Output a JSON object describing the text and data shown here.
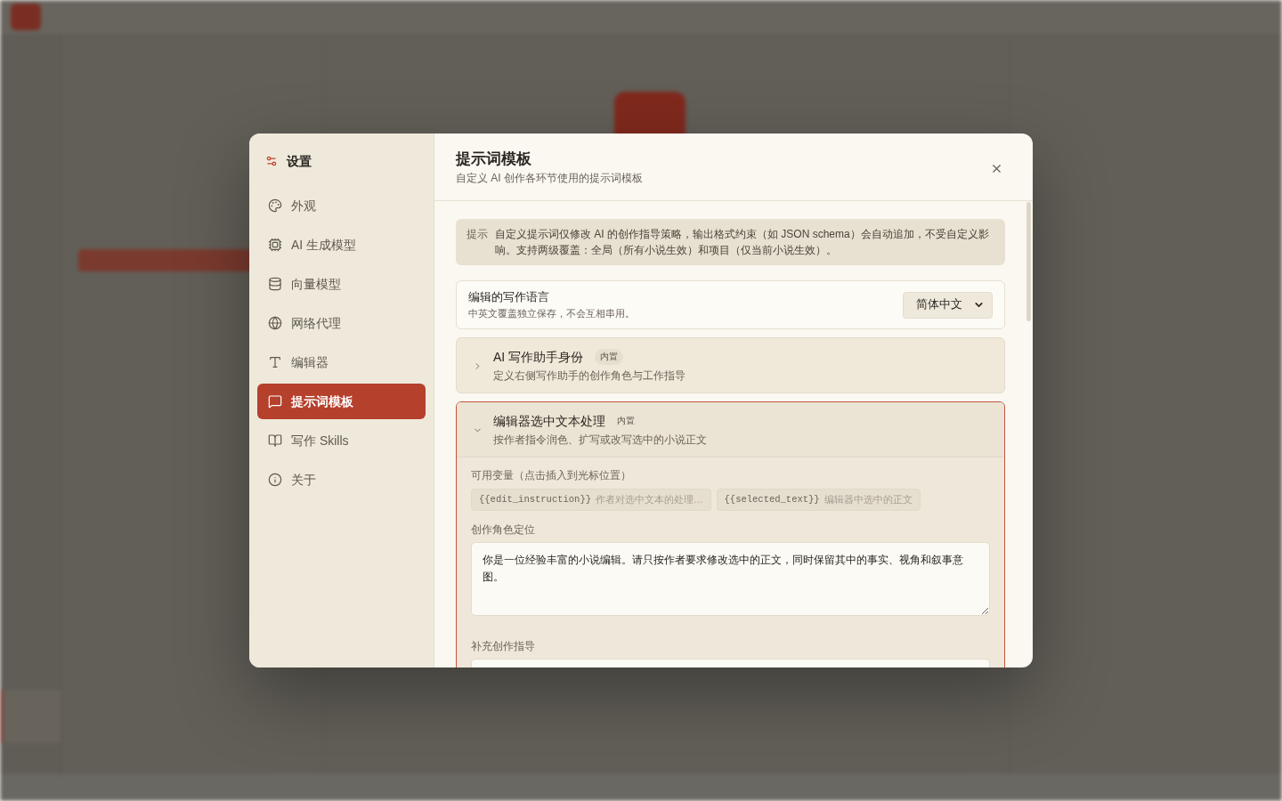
{
  "sidebar": {
    "title": "设置",
    "items": [
      {
        "label": "外观",
        "selected": false
      },
      {
        "label": "AI 生成模型",
        "selected": false
      },
      {
        "label": "向量模型",
        "selected": false
      },
      {
        "label": "网络代理",
        "selected": false
      },
      {
        "label": "编辑器",
        "selected": false
      },
      {
        "label": "提示词模板",
        "selected": true
      },
      {
        "label": "写作 Skills",
        "selected": false
      },
      {
        "label": "关于",
        "selected": false
      }
    ]
  },
  "dialog": {
    "title": "提示词模板",
    "subtitle": "自定义 AI 创作各环节使用的提示词模板"
  },
  "notice": {
    "label": "提示",
    "text": "自定义提示词仅修改 AI 的创作指导策略，输出格式约束（如 JSON schema）会自动追加，不受自定义影响。支持两级覆盖：全局（所有小说生效）和项目（仅当前小说生效）。"
  },
  "language_setting": {
    "title": "编辑的写作语言",
    "description": "中英文覆盖独立保存，不会互相串用。",
    "value": "简体中文"
  },
  "templates": [
    {
      "title": "AI 写作助手身份",
      "badge": "内置",
      "description": "定义右侧写作助手的创作角色与工作指导",
      "expanded": false
    },
    {
      "title": "编辑器选中文本处理",
      "badge": "内置",
      "description": "按作者指令润色、扩写或改写选中的小说正文",
      "expanded": true,
      "variables_label": "可用变量（点击插入到光标位置）",
      "variables": [
        {
          "name": "{{edit_instruction}}",
          "description": "作者对选中文本的处理…"
        },
        {
          "name": "{{selected_text}}",
          "description": "编辑器中选中的正文"
        }
      ],
      "fields": [
        {
          "label": "创作角色定位",
          "value": "你是一位经验丰富的小说编辑。请只按作者要求修改选中的正文，同时保留其中的事实、视角和叙事意图。"
        },
        {
          "label": "补充创作指导"
        }
      ]
    }
  ]
}
